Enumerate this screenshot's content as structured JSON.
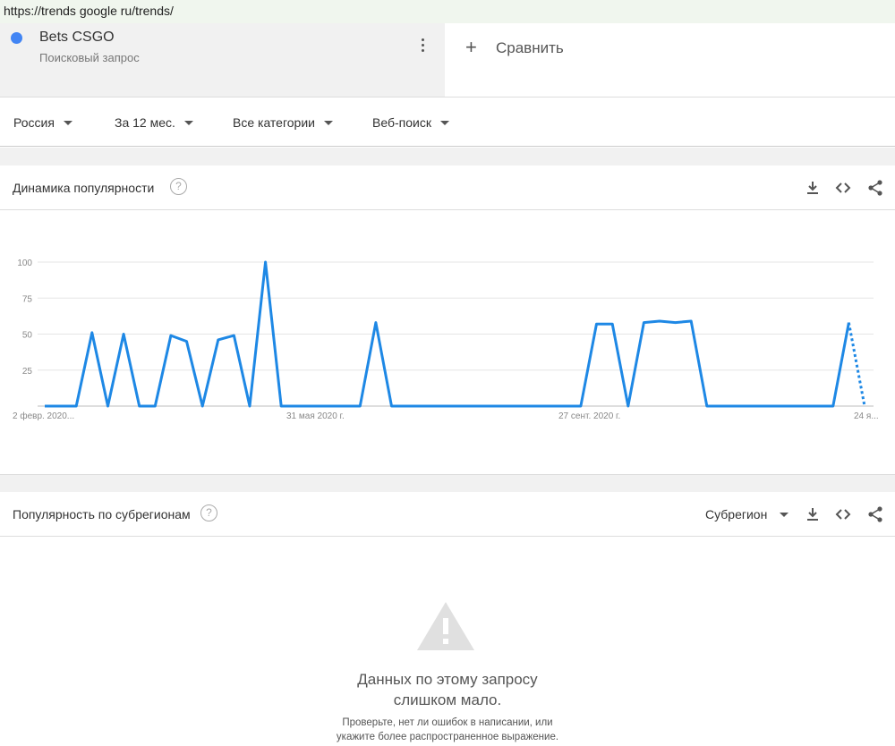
{
  "browser": {
    "url": "https://trends google ru/trends/"
  },
  "term": {
    "color": "#4285f4",
    "name": "Bets CSGO",
    "type": "Поисковый запрос",
    "menu_icon": "more-vert-icon"
  },
  "compare": {
    "icon": "plus-icon",
    "label": "Сравнить"
  },
  "filters": {
    "region": "Россия",
    "period": "За 12 мес.",
    "category": "Все категории",
    "search_type": "Веб-поиск"
  },
  "interest_over_time": {
    "title": "Динамика популярности",
    "tools": [
      "download-icon",
      "embed-icon",
      "share-icon"
    ]
  },
  "chart_data": {
    "type": "line",
    "series_color": "#1e88e5",
    "y_ticks": [
      "100",
      "75",
      "50",
      "25"
    ],
    "ylim": [
      0,
      100
    ],
    "x_tick_labels": [
      "2 февр. 2020...",
      "31 мая 2020 г.",
      "27 сент. 2020 г.",
      "24 я..."
    ],
    "grid": true,
    "x_start": "2020-02-02",
    "x_end": "2021-01-24",
    "partial_last_point": true,
    "values": [
      0,
      0,
      0,
      51,
      0,
      50,
      0,
      0,
      49,
      45,
      0,
      46,
      49,
      0,
      100,
      0,
      0,
      0,
      0,
      0,
      0,
      58,
      0,
      0,
      0,
      0,
      0,
      0,
      0,
      0,
      0,
      0,
      0,
      0,
      0,
      57,
      57,
      0,
      58,
      59,
      58,
      59,
      0,
      0,
      0,
      0,
      0,
      0,
      0,
      0,
      0,
      58,
      0
    ]
  },
  "interest_by_subregion": {
    "title": "Популярность по субрегионам",
    "resolution": "Субрегион",
    "tools": [
      "download-icon",
      "embed-icon",
      "share-icon"
    ],
    "empty_icon": "warning-icon",
    "empty_title_line1": "Данных по этому запросу",
    "empty_title_line2": "слишком мало.",
    "empty_hint_line1": "Проверьте, нет ли ошибок в написании, или",
    "empty_hint_line2": "укажите более распространенное выражение."
  }
}
